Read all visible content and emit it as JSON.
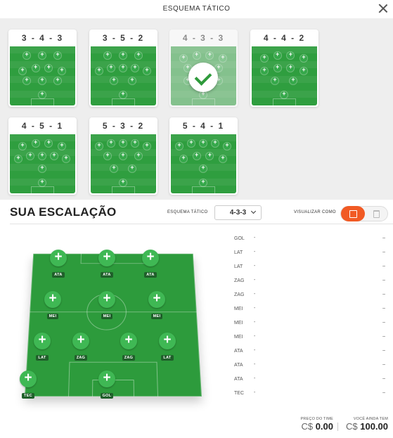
{
  "header": {
    "title": "ESQUEMA TÁTICO"
  },
  "formations": [
    {
      "label": "3 - 4 - 3"
    },
    {
      "label": "3 - 5 - 2"
    },
    {
      "label": "4 - 3 - 3"
    },
    {
      "label": "4 - 4 - 2"
    },
    {
      "label": "4 - 5 - 1"
    },
    {
      "label": "5 - 3 - 2"
    },
    {
      "label": "5 - 4 - 1"
    }
  ],
  "selected_formation": "4 - 3 - 3",
  "lineup": {
    "title": "SUA ESCALAÇÃO",
    "scheme_label": "ESQUEMA TÁTICO",
    "scheme_value": "4-3-3",
    "view_label": "VISUALIZAR COMO"
  },
  "field_players": [
    "ATA",
    "ATA",
    "ATA",
    "MEI",
    "MEI",
    "MEI",
    "LAT",
    "ZAG",
    "ZAG",
    "LAT",
    "TEC",
    "GOL"
  ],
  "roster": [
    {
      "pos": "GOL",
      "dash": "-",
      "end": "–"
    },
    {
      "pos": "LAT",
      "dash": "-",
      "end": "–"
    },
    {
      "pos": "LAT",
      "dash": "-",
      "end": "–"
    },
    {
      "pos": "ZAG",
      "dash": "-",
      "end": "–"
    },
    {
      "pos": "ZAG",
      "dash": "-",
      "end": "–"
    },
    {
      "pos": "MEI",
      "dash": "-",
      "end": "–"
    },
    {
      "pos": "MEI",
      "dash": "-",
      "end": "–"
    },
    {
      "pos": "MEI",
      "dash": "-",
      "end": "–"
    },
    {
      "pos": "ATA",
      "dash": "-",
      "end": "–"
    },
    {
      "pos": "ATA",
      "dash": "-",
      "end": "–"
    },
    {
      "pos": "ATA",
      "dash": "-",
      "end": "–"
    },
    {
      "pos": "TEC",
      "dash": "-",
      "end": "–"
    }
  ],
  "footer": {
    "price_label": "PREÇO DO TIME",
    "price_currency": "C$",
    "price_value": "0.00",
    "remaining_label": "VOCÊ AINDA TEM",
    "remaining_currency": "C$",
    "remaining_value": "100.00"
  },
  "colors": {
    "pitch": "#2d9b3c",
    "accent": "#f15a24",
    "check": "#2e9a3b"
  }
}
